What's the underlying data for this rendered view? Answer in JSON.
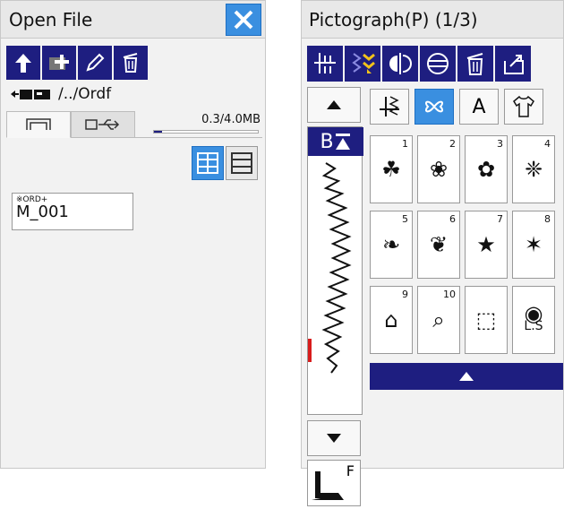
{
  "left": {
    "title": "Open File",
    "path_text": "/../Ordf",
    "capacity_text": "0.3/4.0MB",
    "capacity_fraction": 0.075,
    "file": {
      "tag": "※ORD+",
      "name": "M_001"
    }
  },
  "right": {
    "title": "Pictograph(P) (1/3)",
    "b_label": "B",
    "foot_label": "F",
    "category_letter": "A",
    "patterns": [
      {
        "num": "1",
        "glyph": "☘"
      },
      {
        "num": "2",
        "glyph": "❀"
      },
      {
        "num": "3",
        "glyph": "✿"
      },
      {
        "num": "4",
        "glyph": "❈"
      },
      {
        "num": "5",
        "glyph": "❧"
      },
      {
        "num": "6",
        "glyph": "❦"
      },
      {
        "num": "7",
        "glyph": "★"
      },
      {
        "num": "8",
        "glyph": "✶"
      },
      {
        "num": "9",
        "glyph": "⌂"
      },
      {
        "num": "10",
        "glyph": "⌕"
      },
      {
        "num": "",
        "glyph": "⬚"
      },
      {
        "num": "",
        "glyph": "◉",
        "sub": "L.S"
      }
    ]
  },
  "colors": {
    "navy": "#1e1e80",
    "accent": "#3a8fe0",
    "indicator": "#d81c1c"
  }
}
